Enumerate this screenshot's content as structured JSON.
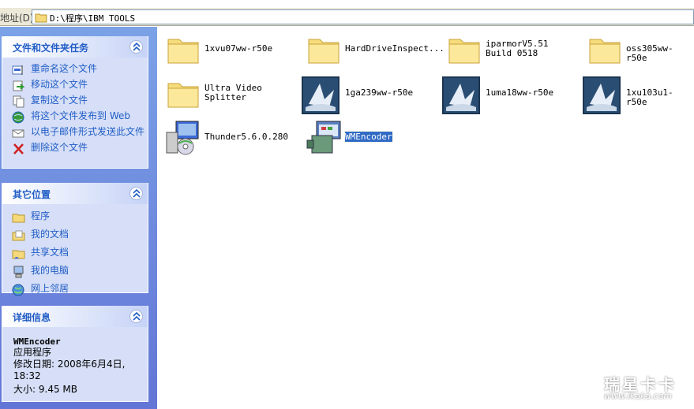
{
  "address": {
    "label": "地址(D)",
    "path": "D:\\程序\\IBM TOOLS"
  },
  "tasks": {
    "title": "文件和文件夹任务",
    "items": [
      {
        "label": "重命名这个文件",
        "icon": "rename-icon"
      },
      {
        "label": "移动这个文件",
        "icon": "move-icon"
      },
      {
        "label": "复制这个文件",
        "icon": "copy-icon"
      },
      {
        "label": "将这个文件发布到 Web",
        "icon": "web-publish-icon"
      },
      {
        "label": "以电子邮件形式发送此文件",
        "icon": "email-icon"
      },
      {
        "label": "删除这个文件",
        "icon": "delete-icon"
      }
    ]
  },
  "places": {
    "title": "其它位置",
    "items": [
      {
        "label": "程序",
        "icon": "folder-icon"
      },
      {
        "label": "我的文档",
        "icon": "my-documents-icon"
      },
      {
        "label": "共享文档",
        "icon": "shared-documents-icon"
      },
      {
        "label": "我的电脑",
        "icon": "my-computer-icon"
      },
      {
        "label": "网上邻居",
        "icon": "network-icon"
      }
    ]
  },
  "details": {
    "title": "详细信息",
    "name": "WMEncoder",
    "type": "应用程序",
    "modified_label": "修改日期:",
    "modified_value": "2008年6月4日, 18:32",
    "size_label": "大小:",
    "size_value": "9.45 MB"
  },
  "files": [
    {
      "name": "1xvu07ww-r50e",
      "icon": "folder-icon"
    },
    {
      "name": "HardDriveInspect...",
      "icon": "folder-icon"
    },
    {
      "name": "iparmorV5.51 Build 0518",
      "icon": "folder-icon"
    },
    {
      "name": "oss305ww-r50e",
      "icon": "folder-icon"
    },
    {
      "name": "Ultra Video Splitter",
      "icon": "folder-icon"
    },
    {
      "name": "1ga239ww-r50e",
      "icon": "installer-app-icon"
    },
    {
      "name": "1uma18ww-r50e",
      "icon": "installer-app-icon"
    },
    {
      "name": "1xu103u1-r50e",
      "icon": "installer-app-icon"
    },
    {
      "name": "Thunder5.6.0.280",
      "icon": "setup-package-icon"
    },
    {
      "name": "WMEncoder",
      "icon": "encoder-app-icon",
      "selected": true
    }
  ],
  "watermark": {
    "brand": "瑞星卡卡",
    "url": "www.ikaka.com"
  }
}
